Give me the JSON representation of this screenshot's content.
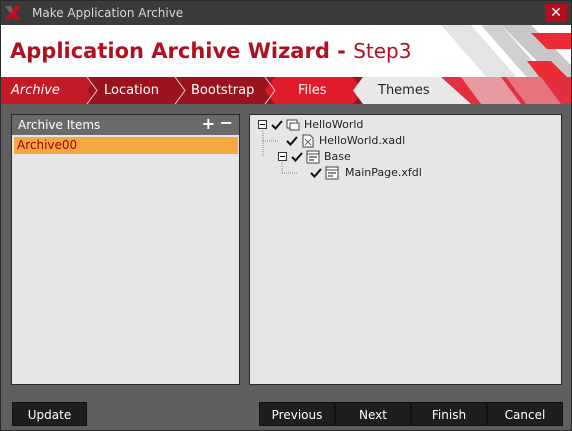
{
  "window": {
    "title": "Make Application Archive",
    "close_glyph": "✕"
  },
  "header": {
    "title": "Application Archive Wizard - ",
    "step": "Step3"
  },
  "steps": [
    {
      "label": "Archive",
      "state": "done-italic"
    },
    {
      "label": "Location",
      "state": "done"
    },
    {
      "label": "Bootstrap",
      "state": "done"
    },
    {
      "label": "Files",
      "state": "current"
    },
    {
      "label": "Themes",
      "state": "pending"
    }
  ],
  "archive_panel": {
    "title": "Archive Items",
    "add_glyph": "+",
    "remove_glyph": "−",
    "items": [
      "Archive00"
    ]
  },
  "tree": {
    "nodes": [
      {
        "label": "HelloWorld",
        "icon": "project-icon",
        "checked": true
      },
      {
        "label": "HelloWorld.xadl",
        "icon": "xadl-file-icon",
        "checked": true
      },
      {
        "label": "Base",
        "icon": "folder-form-icon",
        "checked": true
      },
      {
        "label": "MainPage.xfdl",
        "icon": "form-file-icon",
        "checked": true
      }
    ]
  },
  "buttons": {
    "update": "Update",
    "previous": "Previous",
    "next": "Next",
    "finish": "Finish",
    "cancel": "Cancel"
  },
  "colors": {
    "brand_red": "#b01020",
    "selection": "#f5a840"
  }
}
